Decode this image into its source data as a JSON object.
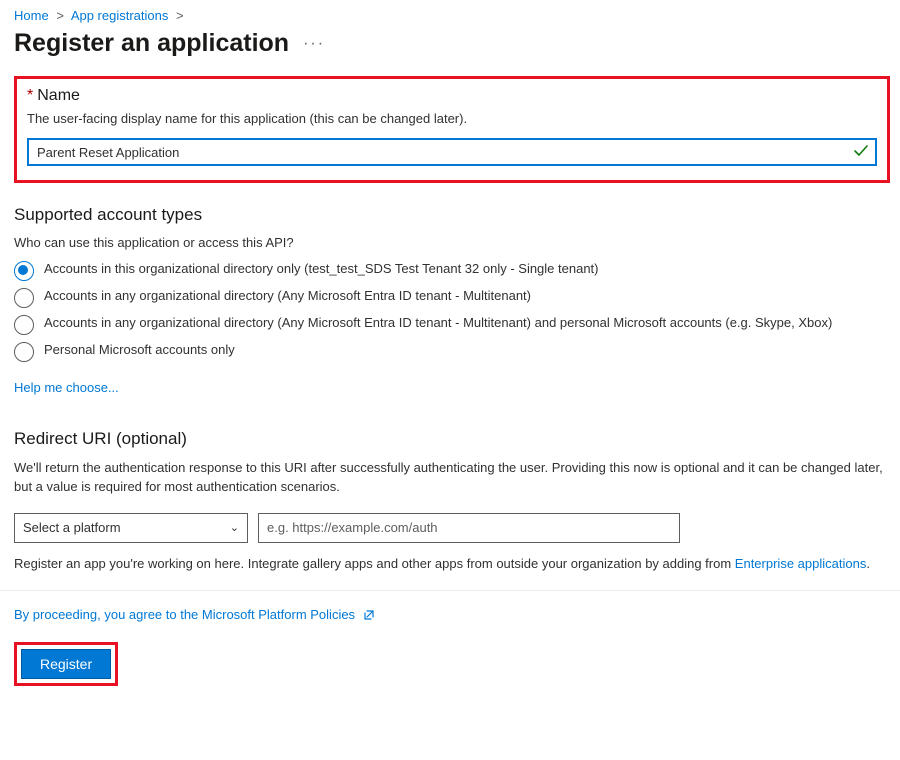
{
  "breadcrumb": {
    "items": [
      "Home",
      "App registrations"
    ],
    "sep": ">"
  },
  "title": "Register an application",
  "name_section": {
    "label": "Name",
    "description": "The user-facing display name for this application (this can be changed later).",
    "value": "Parent Reset Application"
  },
  "account_types": {
    "header": "Supported account types",
    "question": "Who can use this application or access this API?",
    "options": [
      {
        "label": "Accounts in this organizational directory only (test_test_SDS Test Tenant 32 only - Single tenant)",
        "selected": true
      },
      {
        "label": "Accounts in any organizational directory (Any Microsoft Entra ID tenant - Multitenant)",
        "selected": false
      },
      {
        "label": "Accounts in any organizational directory (Any Microsoft Entra ID tenant - Multitenant) and personal Microsoft accounts (e.g. Skype, Xbox)",
        "selected": false
      },
      {
        "label": "Personal Microsoft accounts only",
        "selected": false
      }
    ],
    "help_link": "Help me choose..."
  },
  "redirect": {
    "header": "Redirect URI (optional)",
    "description": "We'll return the authentication response to this URI after successfully authenticating the user. Providing this now is optional and it can be changed later, but a value is required for most authentication scenarios.",
    "platform_placeholder": "Select a platform",
    "uri_placeholder": "e.g. https://example.com/auth"
  },
  "enterprise_note": {
    "prefix": "Register an app you're working on here. Integrate gallery apps and other apps from outside your organization by adding from ",
    "link": "Enterprise applications",
    "suffix": "."
  },
  "agreement": {
    "prefix": "By proceeding, you agree to the ",
    "link": "Microsoft Platform Policies"
  },
  "register_label": "Register"
}
